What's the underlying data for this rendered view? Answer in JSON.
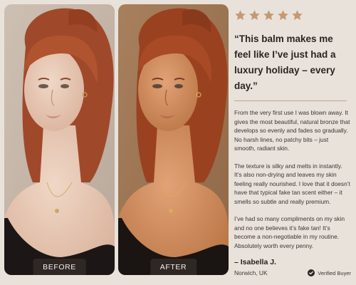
{
  "rating": {
    "stars": 5,
    "star_color": "#c49a73"
  },
  "photos": {
    "before_label": "BEFORE",
    "after_label": "AFTER"
  },
  "review": {
    "quote": "“This balm makes me feel like I’ve just had a luxury holiday – every day.”",
    "paragraphs": [
      "From the very first use I was blown away. It gives the most beautiful, natural bronze that develops so evenly and fades so gradually. No harsh lines, no patchy bits – just smooth, radiant skin.",
      "The texture is silky and melts in instantly. It’s also non-drying and leaves my skin feeling really nourished. I love that it doesn’t have that typical fake tan scent either – it smells so subtle and really premium.",
      "I’ve had so many compliments on my skin and no one believes it’s fake tan! It’s become a non-negotiable in my routine. Absolutely worth every penny."
    ],
    "author": "– Isabella J.",
    "location": "Norwich, UK",
    "verified_label": "Verified Buyer"
  },
  "icons": {
    "star": "star-icon",
    "verified": "check-circle-icon"
  }
}
